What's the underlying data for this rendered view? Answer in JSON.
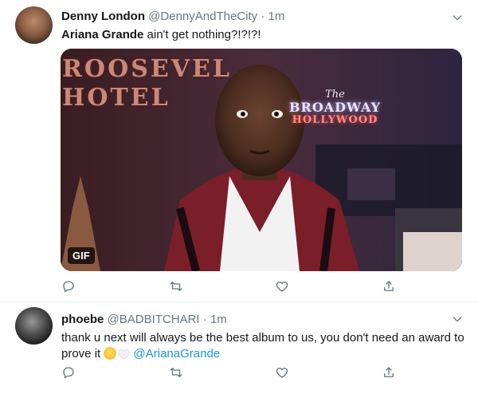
{
  "tweets": [
    {
      "name": "Denny London",
      "handle": "@DennyAndTheCity",
      "separator": "·",
      "time": "1m",
      "text_bold": "Ariana Grande",
      "text_rest": " ain't get nothing?!?!?!",
      "media": {
        "badge": "GIF",
        "sign_left": [
          "ROOSEVEL",
          "HOTEL"
        ],
        "sign_right": {
          "the": "The",
          "main": "BROADWAY",
          "sub": "HOLLYWOOD"
        }
      },
      "icons": [
        "reply-icon",
        "retweet-icon",
        "like-icon",
        "share-icon",
        "chevron-down-icon"
      ]
    },
    {
      "name": "phoebe",
      "handle": "@BADBITCHARI",
      "separator": "·",
      "time": "1m",
      "text": "thank u next will always be the best album to us, you don't need an award to prove it ",
      "mention": "@ArianaGrande",
      "emojis": [
        "relieved-face",
        "white-heart"
      ],
      "icons": [
        "reply-icon",
        "retweet-icon",
        "like-icon",
        "share-icon",
        "chevron-down-icon"
      ]
    }
  ],
  "colors": {
    "name": "#14171a",
    "secondary": "#657786",
    "link": "#1b95e0",
    "divider": "#e6ecf0"
  }
}
